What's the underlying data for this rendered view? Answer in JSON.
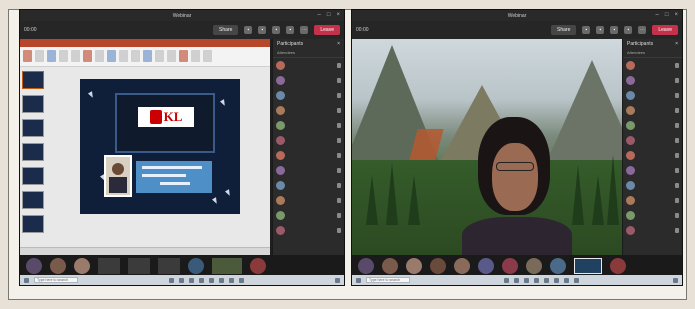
{
  "left_window": {
    "title": "Webinar",
    "time": "00:00",
    "share_label": "Share",
    "leave_label": "Leave",
    "slide": {
      "logo_text": "KL"
    },
    "participants": {
      "header": "Participants",
      "sub": "Attendees",
      "people": [
        "",
        "",
        "",
        "",
        "",
        "",
        "",
        "",
        "",
        "",
        "",
        ""
      ]
    },
    "taskbar_search": "Type here to search"
  },
  "right_window": {
    "title": "Webinar",
    "time": "00:00",
    "share_label": "Share",
    "leave_label": "Leave",
    "participants": {
      "header": "Participants",
      "sub": "Attendees",
      "people": [
        "",
        "",
        "",
        "",
        "",
        "",
        "",
        "",
        "",
        "",
        "",
        ""
      ]
    },
    "taskbar_search": "Type here to search"
  }
}
